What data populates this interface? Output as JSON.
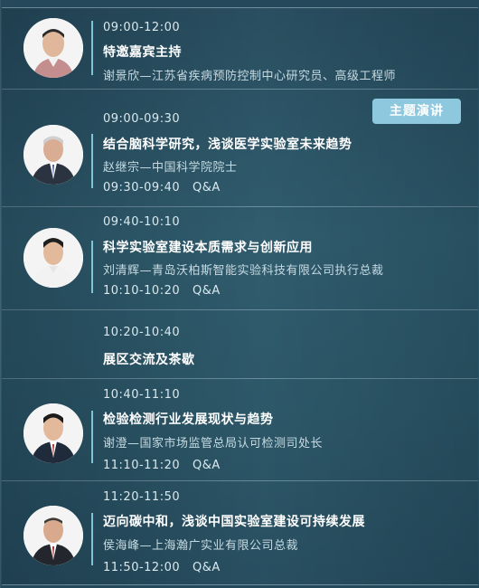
{
  "badge": "主题演讲",
  "sessions": [
    {
      "time": "09:00-12:00",
      "title": "特邀嘉宾主持",
      "speaker": "谢景欣—江苏省疾病预防控制中心研究员、高级工程师"
    },
    {
      "time": "09:00-09:30",
      "title": "结合脑科学研究，浅谈医学实验室未来趋势",
      "speaker": "赵继宗—中国科学院院士",
      "qa_time": "09:30-09:40",
      "qa": "Q&A"
    },
    {
      "time": "09:40-10:10",
      "title": "科学实验室建设本质需求与创新应用",
      "speaker": "刘清辉—青岛沃柏斯智能实验科技有限公司执行总裁",
      "qa_time": "10:10-10:20",
      "qa": "Q&A"
    },
    {
      "time": "10:20-10:40",
      "title": "展区交流及茶歇"
    },
    {
      "time": "10:40-11:10",
      "title": "检验检测行业发展现状与趋势",
      "speaker": "谢澄—国家市场监管总局认可检测司处长",
      "qa_time": "11:10-11:20",
      "qa": "Q&A"
    },
    {
      "time": "11:20-11:50",
      "title": "迈向碳中和，浅谈中国实验室建设可持续发展",
      "speaker": "侯海峰—上海瀚广实业有限公司总裁",
      "qa_time": "11:50-12:00",
      "qa": "Q&A"
    }
  ]
}
